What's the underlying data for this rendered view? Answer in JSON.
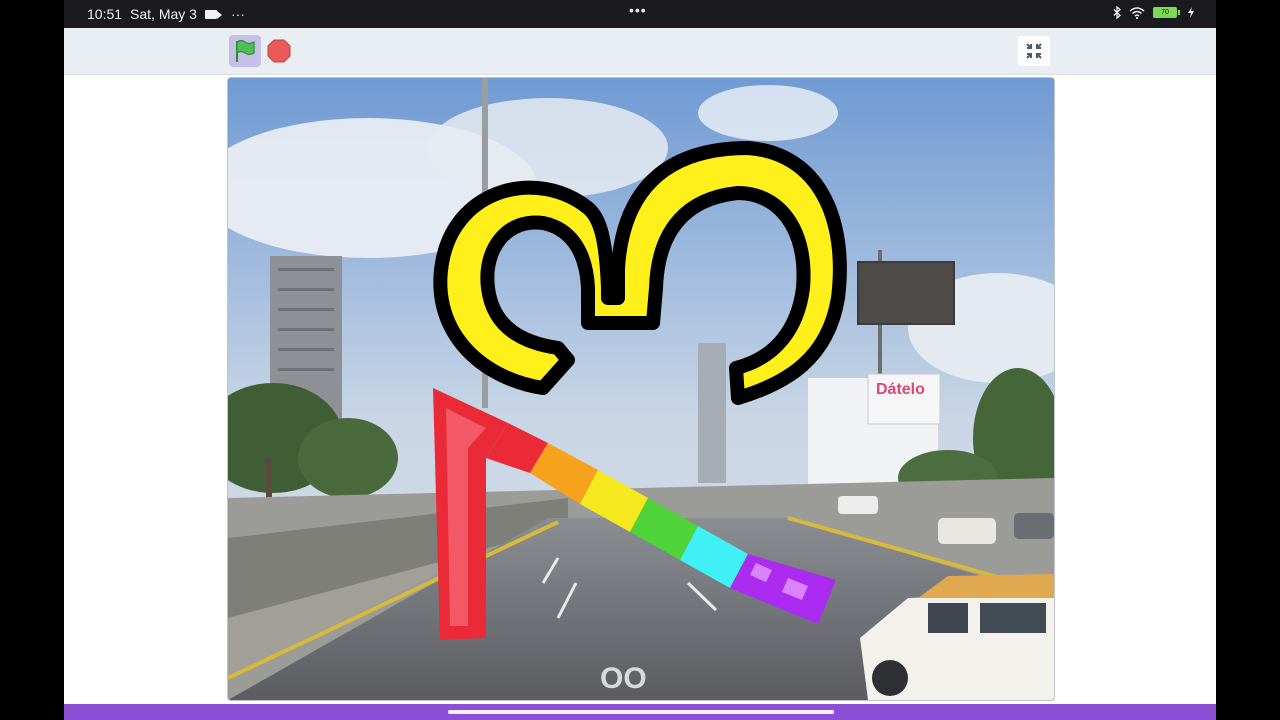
{
  "status_bar": {
    "time": "10:51",
    "date": "Sat, May 3",
    "notification_more": "···",
    "center_dots": "•••",
    "battery": "70",
    "icons": [
      "video-camera-icon",
      "bluetooth-icon",
      "wifi-icon",
      "battery-icon",
      "charging-icon"
    ]
  },
  "player": {
    "controls": [
      "green-flag-icon",
      "stop-icon",
      "exit-fullscreen-icon"
    ],
    "accent_colors": {
      "flag_bg": "#c8bfe7",
      "flag": "#4cbf56",
      "stop": "#ec5959",
      "bottom_bar": "#8c50d6"
    }
  },
  "stage": {
    "background_billboard_text": "Dátelo",
    "road_marking": "OO",
    "sprites": [
      "yellow-heart-sprite",
      "rainbow-arrow-sprite"
    ]
  }
}
